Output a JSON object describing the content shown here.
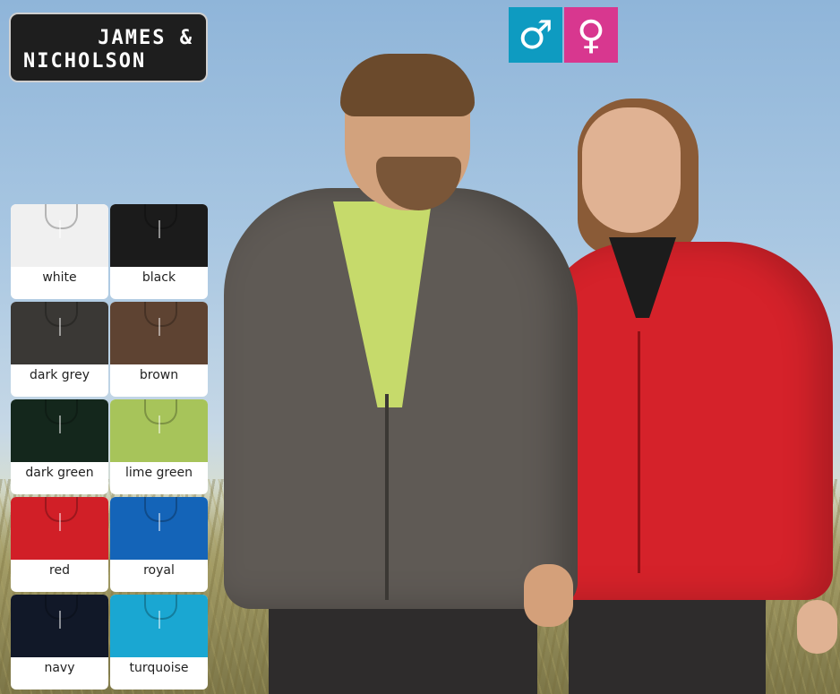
{
  "brand": {
    "line1": "JAMES &",
    "line2": "NICHOLSON"
  },
  "gender_icons": [
    {
      "icon": "male-symbol-icon",
      "glyph": "♂",
      "color": "#0e9bc1"
    },
    {
      "icon": "female-symbol-icon",
      "glyph": "♀",
      "color": "#d8378f"
    }
  ],
  "swatches": [
    {
      "label": "white",
      "color": "#f0f0f0"
    },
    {
      "label": "black",
      "color": "#1b1b1b"
    },
    {
      "label": "dark grey",
      "color": "#3a3835"
    },
    {
      "label": "brown",
      "color": "#5e4332"
    },
    {
      "label": "dark green",
      "color": "#14271c"
    },
    {
      "label": "lime green",
      "color": "#a7c45a"
    },
    {
      "label": "red",
      "color": "#d11f27"
    },
    {
      "label": "royal",
      "color": "#1464b8"
    },
    {
      "label": "navy",
      "color": "#111828"
    },
    {
      "label": "turquoise",
      "color": "#1aa7d2"
    }
  ]
}
